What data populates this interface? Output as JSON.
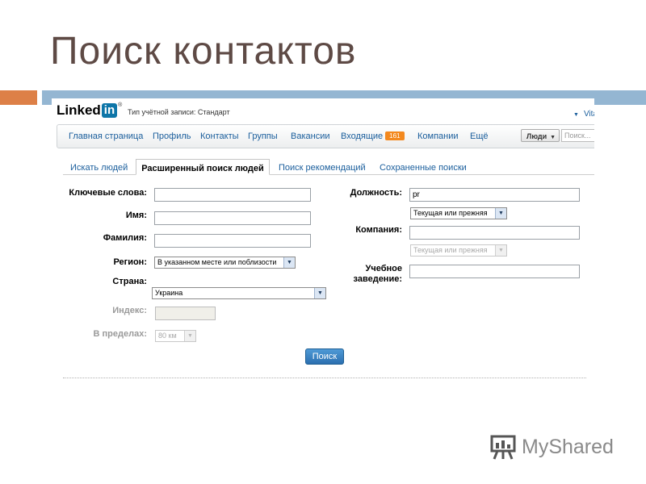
{
  "slide": {
    "title": "Поиск контактов"
  },
  "header": {
    "logo_text": "Linked",
    "logo_in": "in",
    "logo_reg": "®",
    "account_type": "Тип учётной записи: Стандарт",
    "user_name": "Vita"
  },
  "nav": {
    "items": [
      "Главная страница",
      "Профиль",
      "Контакты",
      "Группы",
      "Вакансии",
      "Входящие",
      "Компании",
      "Ещё"
    ],
    "inbox_badge": "161",
    "people_label": "Люди",
    "search_placeholder": "Поиск..."
  },
  "tabs": {
    "items": [
      "Искать людей",
      "Расширенный поиск людей",
      "Поиск рекомендаций",
      "Сохраненные поиски"
    ],
    "active_index": 1
  },
  "form": {
    "keywords_label": "Ключевые слова:",
    "keywords_value": "",
    "first_name_label": "Имя:",
    "first_name_value": "",
    "last_name_label": "Фамилия:",
    "last_name_value": "",
    "region_label": "Регион:",
    "region_value": "В указанном месте или поблизости",
    "country_label": "Страна:",
    "country_value": "Украина",
    "zip_label": "Индекс:",
    "zip_value": "",
    "radius_label": "В пределах:",
    "radius_value": "80 км",
    "title_label": "Должность:",
    "title_value": "pr",
    "title_scope": "Текущая или прежняя",
    "company_label": "Компания:",
    "company_value": "",
    "company_scope": "Текущая или прежняя",
    "school_label_1": "Учебное",
    "school_label_2": "заведение:",
    "school_value": "",
    "search_button": "Поиск"
  },
  "watermark": {
    "text": "MyShared"
  },
  "colors": {
    "linkedin_blue": "#0e76a8",
    "link": "#1a5e9c",
    "badge": "#f3891f",
    "band_orange": "#dd8047",
    "band_blue": "#94b6d2"
  }
}
